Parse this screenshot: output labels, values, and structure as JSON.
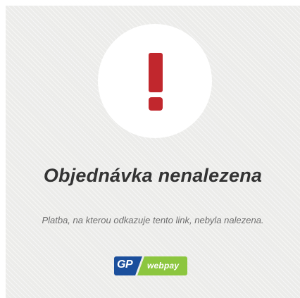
{
  "error": {
    "title": "Objednávka nenalezena",
    "message": "Platba, na kterou odkazuje tento link, nebyla nalezena."
  },
  "logo": {
    "left_text": "GP",
    "right_text": "webpay",
    "colors": {
      "blue": "#1b4f9c",
      "green": "#8cc63f"
    }
  },
  "icon": {
    "name": "exclamation-icon",
    "color": "#c1272d"
  }
}
